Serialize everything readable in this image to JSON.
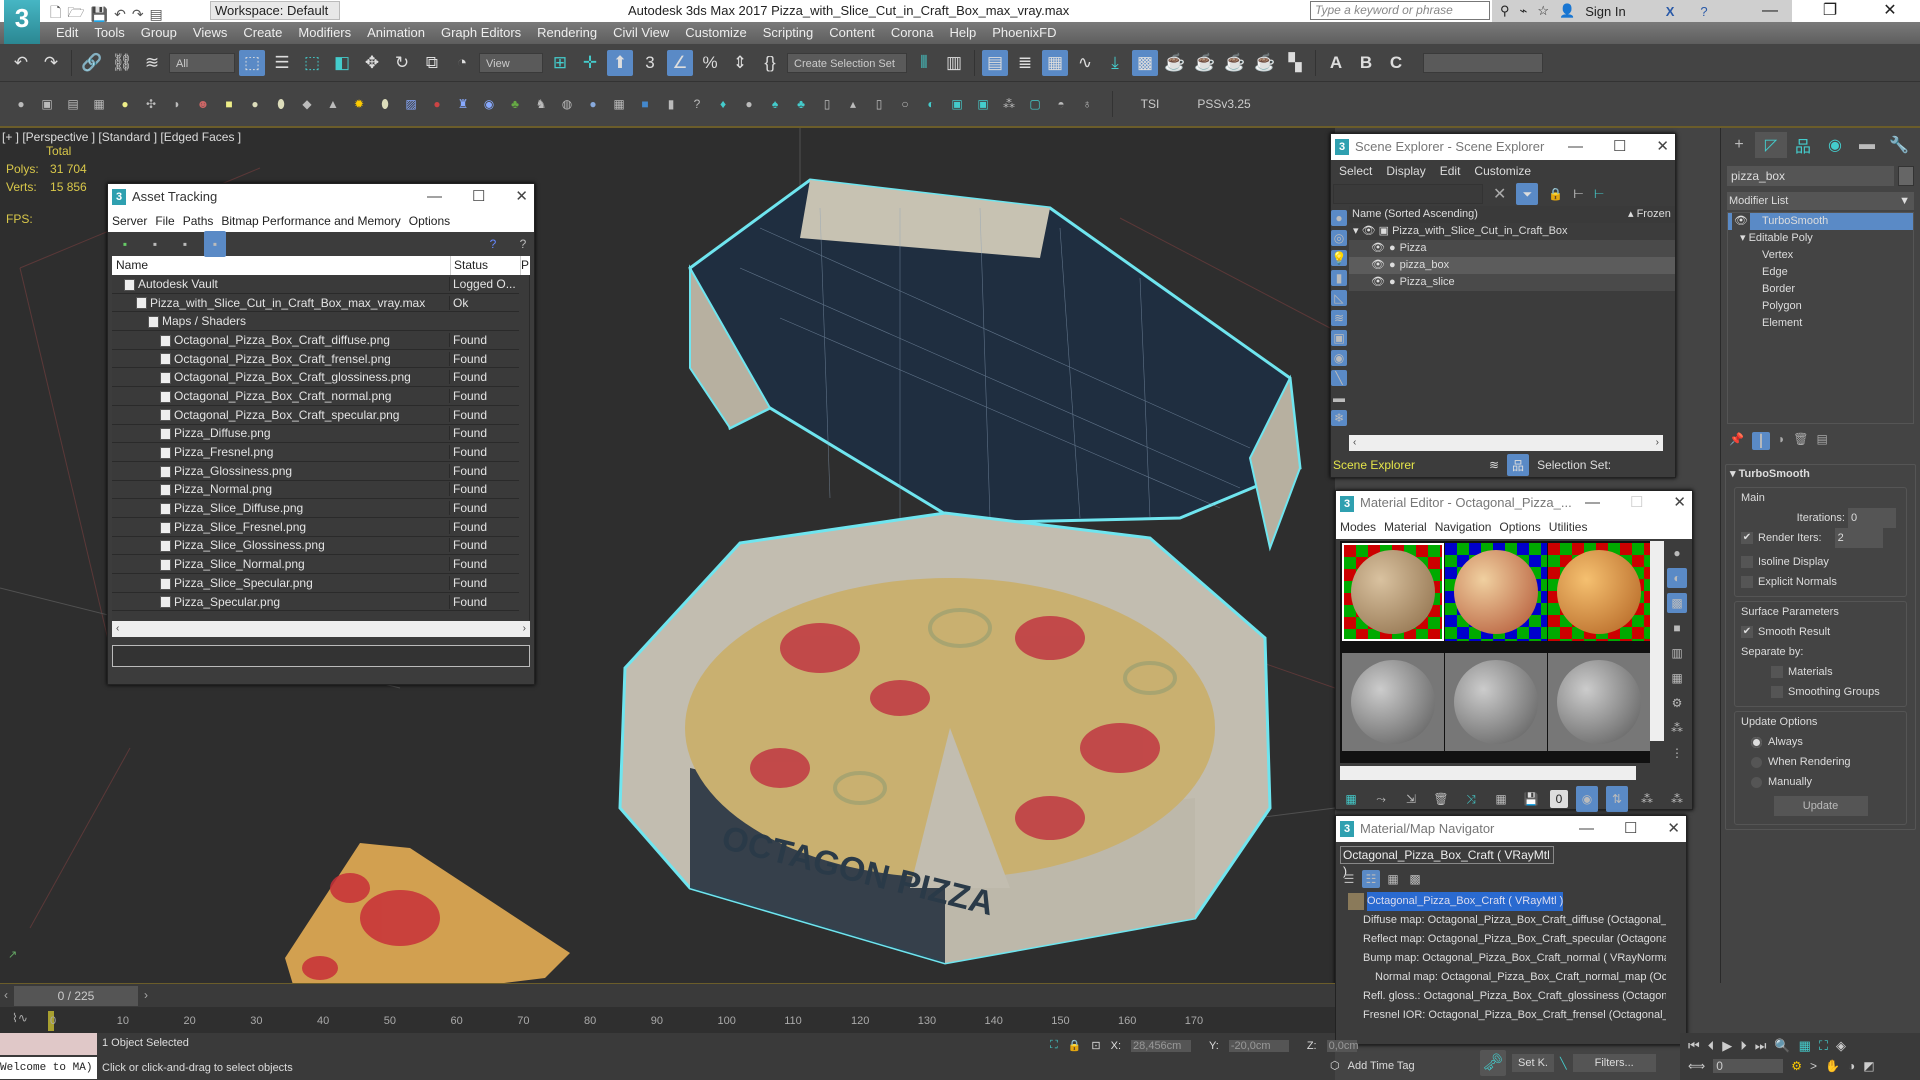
{
  "app": {
    "logo": "3",
    "workspace": "Workspace: Default",
    "title": "Autodesk 3ds Max 2017    Pizza_with_Slice_Cut_in_Craft_Box_max_vray.max",
    "search_placeholder": "Type a keyword or phrase",
    "sign_in": "Sign In",
    "window_controls": [
      "—",
      "❐",
      "✕"
    ]
  },
  "menu": [
    "Edit",
    "Tools",
    "Group",
    "Views",
    "Create",
    "Modifiers",
    "Animation",
    "Graph Editors",
    "Rendering",
    "Civil View",
    "Customize",
    "Scripting",
    "Content",
    "Corona",
    "Help",
    "PhoenixFD"
  ],
  "toolbar": {
    "selection_filter": "All",
    "ref_coord": "View",
    "create_selection_set": "Create Selection Set",
    "tsi": "TSI",
    "pss": "PSSv3.25"
  },
  "viewport": {
    "label": "[+ ] [Perspective ]  [Standard ] [Edged Faces ]",
    "stats_header": "Total",
    "polys_label": "Polys:",
    "polys": "31 704",
    "verts_label": "Verts:",
    "verts": "15 856",
    "fps_label": "FPS:",
    "box_text": "OCTAGON PIZZA"
  },
  "asset_tracking": {
    "title": "Asset Tracking",
    "menu": [
      "Server",
      "File",
      "Paths",
      "Bitmap Performance and Memory",
      "Options"
    ],
    "columns": [
      "Name",
      "Status",
      "P"
    ],
    "rows": [
      {
        "name": "Autodesk Vault",
        "status": "Logged O...",
        "indent": 1
      },
      {
        "name": "Pizza_with_Slice_Cut_in_Craft_Box_max_vray.max",
        "status": "Ok",
        "indent": 2
      },
      {
        "name": "Maps / Shaders",
        "status": "",
        "indent": 3
      },
      {
        "name": "Octagonal_Pizza_Box_Craft_diffuse.png",
        "status": "Found",
        "indent": 4
      },
      {
        "name": "Octagonal_Pizza_Box_Craft_frensel.png",
        "status": "Found",
        "indent": 4
      },
      {
        "name": "Octagonal_Pizza_Box_Craft_glossiness.png",
        "status": "Found",
        "indent": 4
      },
      {
        "name": "Octagonal_Pizza_Box_Craft_normal.png",
        "status": "Found",
        "indent": 4
      },
      {
        "name": "Octagonal_Pizza_Box_Craft_specular.png",
        "status": "Found",
        "indent": 4
      },
      {
        "name": "Pizza_Diffuse.png",
        "status": "Found",
        "indent": 4
      },
      {
        "name": "Pizza_Fresnel.png",
        "status": "Found",
        "indent": 4
      },
      {
        "name": "Pizza_Glossiness.png",
        "status": "Found",
        "indent": 4
      },
      {
        "name": "Pizza_Normal.png",
        "status": "Found",
        "indent": 4
      },
      {
        "name": "Pizza_Slice_Diffuse.png",
        "status": "Found",
        "indent": 4
      },
      {
        "name": "Pizza_Slice_Fresnel.png",
        "status": "Found",
        "indent": 4
      },
      {
        "name": "Pizza_Slice_Glossiness.png",
        "status": "Found",
        "indent": 4
      },
      {
        "name": "Pizza_Slice_Normal.png",
        "status": "Found",
        "indent": 4
      },
      {
        "name": "Pizza_Slice_Specular.png",
        "status": "Found",
        "indent": 4
      },
      {
        "name": "Pizza_Specular.png",
        "status": "Found",
        "indent": 4
      }
    ]
  },
  "scene_explorer": {
    "title": "Scene Explorer - Scene Explorer",
    "menu": [
      "Select",
      "Display",
      "Edit",
      "Customize"
    ],
    "col_name": "Name (Sorted Ascending)",
    "col_frozen": "Frozen",
    "root": "Pizza_with_Slice_Cut_in_Craft_Box",
    "items": [
      "Pizza",
      "pizza_box",
      "Pizza_slice"
    ],
    "selected": "pizza_box",
    "footer_dropdown": "Scene Explorer",
    "selection_set_label": "Selection Set:"
  },
  "material_editor": {
    "title": "Material Editor - Octagonal_Pizza_...",
    "menu": [
      "Modes",
      "Material",
      "Navigation",
      "Options",
      "Utilities"
    ],
    "material_name": "Octagonal_Pizza_Box_Craft",
    "material_type": "VRayMtl",
    "slot_value": "0"
  },
  "map_navigator": {
    "title": "Material/Map Navigator",
    "field": "Octagonal_Pizza_Box_Craft  ( VRayMtl )",
    "items": [
      {
        "text": "Octagonal_Pizza_Box_Craft  ( VRayMtl )",
        "level": 0,
        "swatch": "#8a7a5a",
        "selected": true
      },
      {
        "text": "Diffuse map: Octagonal_Pizza_Box_Craft_diffuse (Octagonal_P",
        "level": 1,
        "swatch": "#b9a080"
      },
      {
        "text": "Reflect map: Octagonal_Pizza_Box_Craft_specular (Octagonal_",
        "level": 1,
        "swatch": "#dcc4a0"
      },
      {
        "text": "Bump map: Octagonal_Pizza_Box_Craft_normal  ( VRayNorma",
        "level": 1,
        "swatch": "#b8b8f4"
      },
      {
        "text": "Normal map: Octagonal_Pizza_Box_Craft_normal_map (Octa",
        "level": 2,
        "swatch": "#b8b8f4"
      },
      {
        "text": "Refl. gloss.: Octagonal_Pizza_Box_Craft_glossiness (Octagonal",
        "level": 1,
        "swatch": "#c8c8c8"
      },
      {
        "text": "Fresnel IOR: Octagonal_Pizza_Box_Craft_frensel (Octagonal_F",
        "level": 1,
        "swatch": "#ececec"
      }
    ]
  },
  "command_panel": {
    "object_name": "pizza_box",
    "modifier_list": "Modifier List",
    "stack": [
      {
        "name": "TurboSmooth",
        "selected": true
      },
      {
        "name": "Editable Poly",
        "selected": false
      }
    ],
    "sub_objects": [
      "Vertex",
      "Edge",
      "Border",
      "Polygon",
      "Element"
    ],
    "rollout_title": "TurboSmooth",
    "main_label": "Main",
    "iterations_label": "Iterations:",
    "iterations": "0",
    "render_iters_label": "Render Iters:",
    "render_iters": "2",
    "render_iters_checked": true,
    "isoline_label": "Isoline Display",
    "isoline_checked": false,
    "explicit_normals_label": "Explicit Normals",
    "explicit_normals_checked": false,
    "surface_label": "Surface Parameters",
    "smooth_result_label": "Smooth Result",
    "smooth_result_checked": true,
    "separate_by_label": "Separate by:",
    "materials_label": "Materials",
    "smoothing_groups_label": "Smoothing Groups",
    "update_options_label": "Update Options",
    "update_options": [
      "Always",
      "When Rendering",
      "Manually"
    ],
    "update_selected": "Always",
    "update_button": "Update"
  },
  "timeline": {
    "frame_display": "0 / 225",
    "ticks": [
      "0",
      "10",
      "20",
      "30",
      "40",
      "50",
      "60",
      "70",
      "80",
      "90",
      "100",
      "110",
      "120",
      "130",
      "140",
      "150",
      "160",
      "170"
    ],
    "current_frame": 0,
    "total_frames": 225
  },
  "status": {
    "script_listener": "Welcome to MA)",
    "selected": "1 Object Selected",
    "prompt": "Click or click-and-drag to select objects",
    "x_label": "X:",
    "x": "28,456cm",
    "y_label": "Y:",
    "y": "-20,0cm",
    "z_label": "Z:",
    "z": "0,0cm",
    "add_time_tag": "Add Time Tag",
    "set_key": "Set K.",
    "filters": "Filters...",
    "frame_spinner": "0"
  }
}
